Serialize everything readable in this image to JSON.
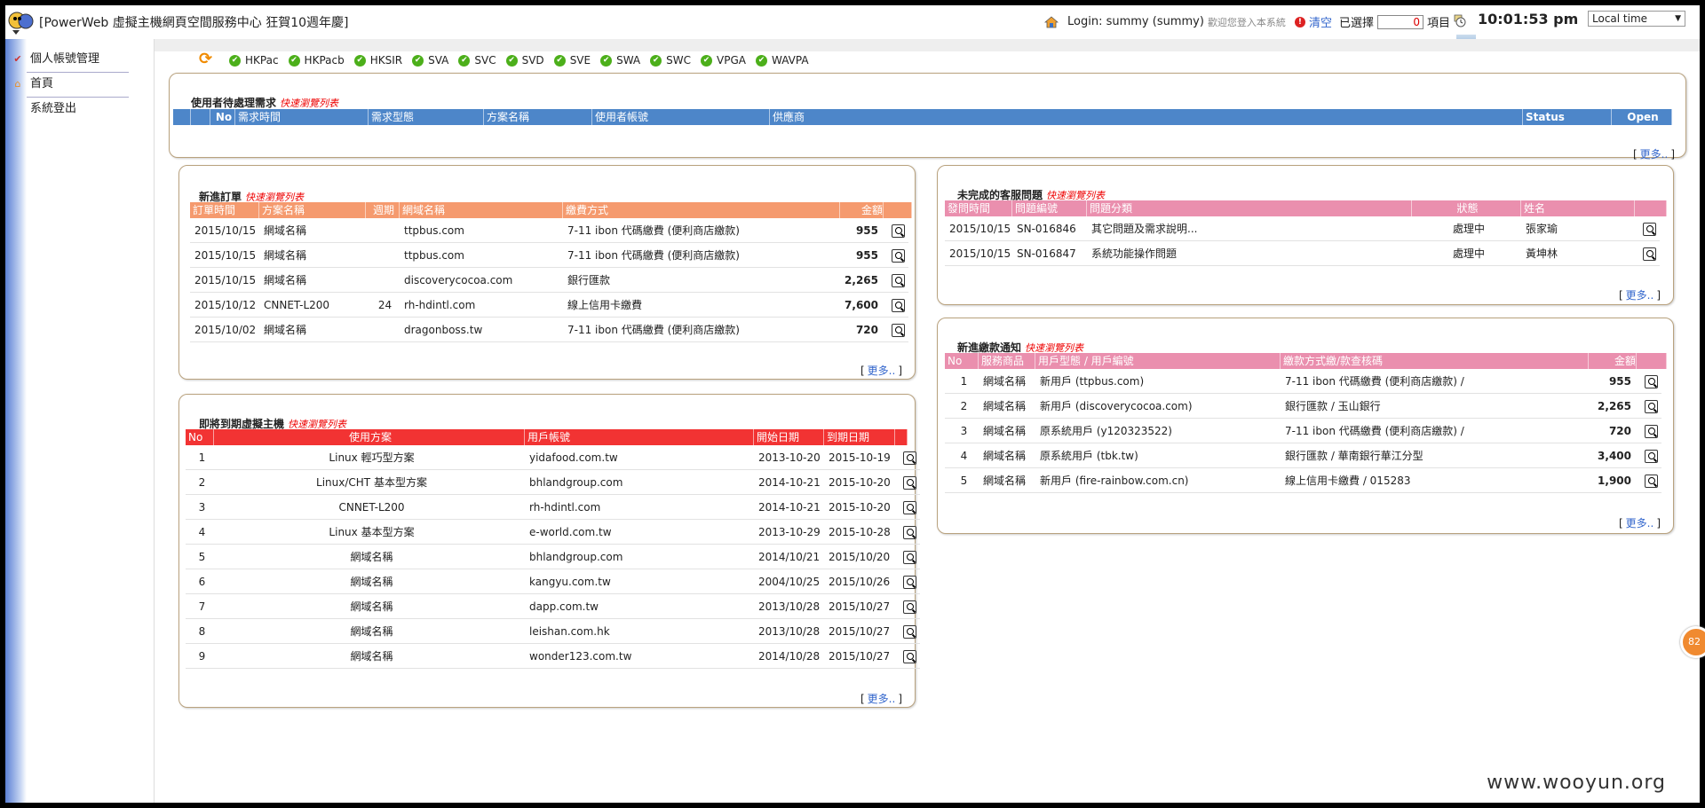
{
  "app": {
    "title": "[PowerWeb 虛擬主機網頁空間服務中心 狂賀10週年慶]"
  },
  "user": {
    "login": "Login: summy (summy)",
    "welcome": "歡迎您登入本系統",
    "clear": "清空",
    "selected_label": "已選擇",
    "selected_count": "0",
    "items_label": "項目"
  },
  "clock": {
    "time": "10:01:53 pm",
    "timezone": "Local time"
  },
  "sidebar": {
    "items": [
      {
        "label": "個人帳號管理",
        "icon": "checklist-icon"
      },
      {
        "label": "首頁",
        "icon": "home-icon"
      },
      {
        "label": "系統登出",
        "icon": ""
      }
    ]
  },
  "servers": [
    "HKPac",
    "HKPacb",
    "HKSIR",
    "SVA",
    "SVC",
    "SVD",
    "SVE",
    "SWA",
    "SWC",
    "VPGA",
    "WAVPA"
  ],
  "quick_label": "快速瀏覽列表",
  "more_label": "更多..",
  "colors": {
    "blue": "#4d86c9",
    "orange": "#f59a6e",
    "red": "#f23333",
    "pink": "#ea8fae"
  },
  "pending": {
    "title": "使用者待處理需求",
    "cols": [
      "No",
      "需求時間",
      "需求型態",
      "方案名稱",
      "使用者帳號",
      "供應商",
      "Status",
      "Open"
    ]
  },
  "orders": {
    "title": "新進訂單",
    "cols": [
      "訂單時間",
      "方案名稱",
      "週期",
      "網域名稱",
      "繳費方式",
      "金額"
    ],
    "rows": [
      [
        "2015/10/15",
        "網域名稱",
        "",
        "ttpbus.com",
        "7-11 ibon 代碼繳費 (便利商店繳款)",
        "955"
      ],
      [
        "2015/10/15",
        "網域名稱",
        "",
        "ttpbus.com",
        "7-11 ibon 代碼繳費 (便利商店繳款)",
        "955"
      ],
      [
        "2015/10/15",
        "網域名稱",
        "",
        "discoverycocoa.com",
        "銀行匯款",
        "2,265"
      ],
      [
        "2015/10/12",
        "CNNET-L200",
        "24",
        "rh-hdintl.com",
        "線上信用卡繳費",
        "7,600"
      ],
      [
        "2015/10/02",
        "網域名稱",
        "",
        "dragonboss.tw",
        "7-11 ibon 代碼繳費 (便利商店繳款)",
        "720"
      ]
    ]
  },
  "expiring": {
    "title": "即將到期虛擬主機",
    "cols": [
      "No",
      "使用方案",
      "用戶帳號",
      "開始日期",
      "到期日期"
    ],
    "rows": [
      [
        "1",
        "Linux 輕巧型方案",
        "yidafood.com.tw",
        "2013-10-20",
        "2015-10-19"
      ],
      [
        "2",
        "Linux/CHT 基本型方案",
        "bhlandgroup.com",
        "2014-10-21",
        "2015-10-20"
      ],
      [
        "3",
        "CNNET-L200",
        "rh-hdintl.com",
        "2014-10-21",
        "2015-10-20"
      ],
      [
        "4",
        "Linux 基本型方案",
        "e-world.com.tw",
        "2013-10-29",
        "2015-10-28"
      ],
      [
        "5",
        "網域名稱",
        "bhlandgroup.com",
        "2014/10/21",
        "2015/10/20"
      ],
      [
        "6",
        "網域名稱",
        "kangyu.com.tw",
        "2004/10/25",
        "2015/10/26"
      ],
      [
        "7",
        "網域名稱",
        "dapp.com.tw",
        "2013/10/28",
        "2015/10/27"
      ],
      [
        "8",
        "網域名稱",
        "leishan.com.hk",
        "2013/10/28",
        "2015/10/27"
      ],
      [
        "9",
        "網域名稱",
        "wonder123.com.tw",
        "2014/10/28",
        "2015/10/27"
      ]
    ]
  },
  "tickets": {
    "title": "未完成的客服問題",
    "cols": [
      "發問時間",
      "問題編號",
      "問題分類",
      "狀態",
      "姓名"
    ],
    "rows": [
      [
        "2015/10/15",
        "SN-016846",
        "其它問題及需求說明...",
        "處理中",
        "張家瑜"
      ],
      [
        "2015/10/15",
        "SN-016847",
        "系統功能操作問題",
        "處理中",
        "黃坤林"
      ]
    ]
  },
  "payments": {
    "title": "新進繳款通知",
    "cols": [
      "No",
      "服務商品",
      "用戶型態 / 用戶編號",
      "繳款方式繳/款查核碼",
      "金額"
    ],
    "rows": [
      [
        "1",
        "網域名稱",
        "新用戶 (ttpbus.com)",
        "7-11 ibon 代碼繳費 (便利商店繳款) /",
        "955"
      ],
      [
        "2",
        "網域名稱",
        "新用戶 (discoverycocoa.com)",
        "銀行匯款 / 玉山銀行",
        "2,265"
      ],
      [
        "3",
        "網域名稱",
        "原系統用戶 (y120323522)",
        "7-11 ibon 代碼繳費 (便利商店繳款) /",
        "720"
      ],
      [
        "4",
        "網域名稱",
        "原系統用戶 (tbk.tw)",
        "銀行匯款 / 華南銀行華江分型",
        "3,400"
      ],
      [
        "5",
        "網域名稱",
        "新用戶 (fire-rainbow.com.cn)",
        "線上信用卡繳費 / 015283",
        "1,900"
      ]
    ]
  },
  "watermark": "www.wooyun.org",
  "badge": "82"
}
